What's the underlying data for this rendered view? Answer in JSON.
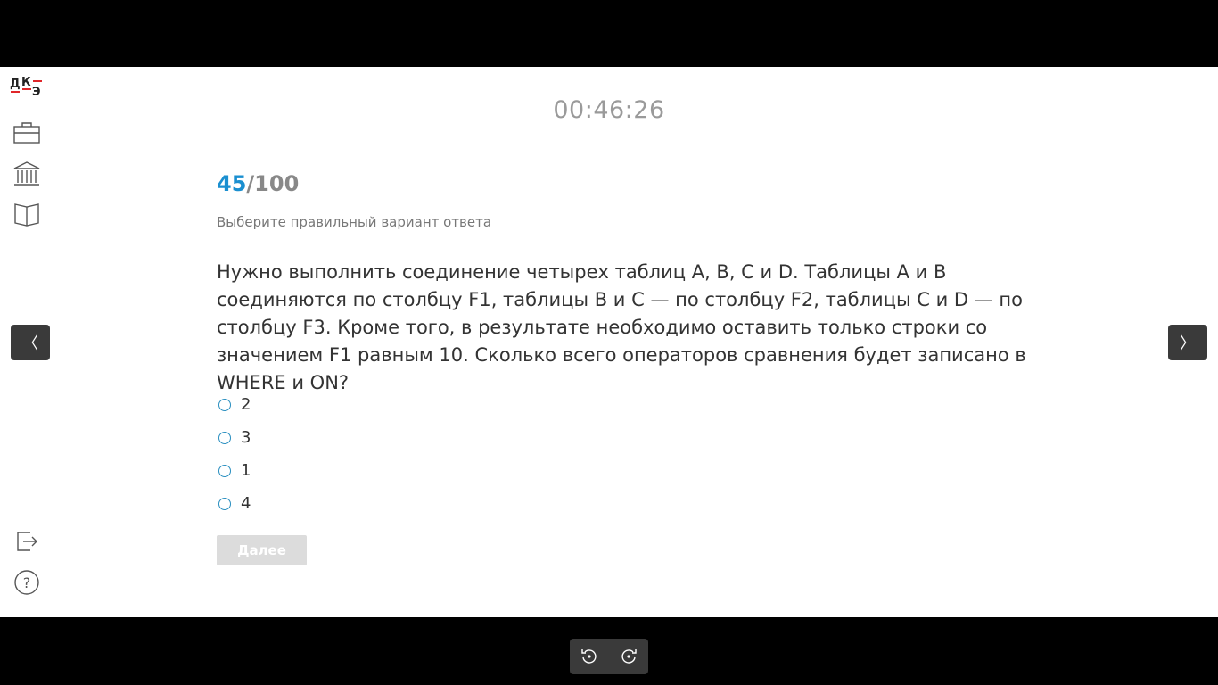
{
  "app": {
    "logo_text": "ДКЭ"
  },
  "sidebar": {
    "icons": [
      "briefcase-icon",
      "bank-icon",
      "book-icon",
      "exit-icon",
      "help-icon"
    ]
  },
  "timer": "00:46:26",
  "progress": {
    "current": "45",
    "total": "/100"
  },
  "instruction": "Выберите правильный вариант ответа",
  "question": "Нужно выполнить соединение четырех таблиц A, B, C и D. Таблицы A и B соединяются по столбцу F1, таблицы B и C — по столбцу F2, таблицы C и D — по столбцу F3. Кроме того, в результате необходимо оставить только строки со значением F1 равным 10. Сколько всего операторов сравнения будет записано в WHERE и ON?",
  "options": [
    {
      "label": "2"
    },
    {
      "label": "3"
    },
    {
      "label": "1"
    },
    {
      "label": "4"
    }
  ],
  "next_button_label": "Далее",
  "nav": {
    "prev_symbol": "〈",
    "next_symbol": "〉"
  },
  "colors": {
    "accent": "#1a8fd0",
    "logo_red": "#e0262a"
  }
}
